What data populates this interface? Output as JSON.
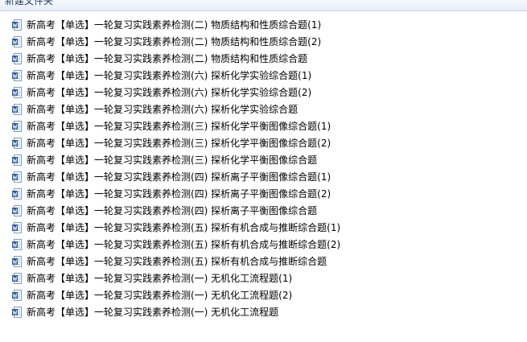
{
  "toolbar": {
    "new_folder_label": "新建文件夹"
  },
  "files": [
    {
      "name": "新高考【单选】一轮复习实践素养检测(二)   物质结构和性质综合题(1)",
      "icon": "word-document-icon"
    },
    {
      "name": "新高考【单选】一轮复习实践素养检测(二)   物质结构和性质综合题(2)",
      "icon": "word-document-icon"
    },
    {
      "name": "新高考【单选】一轮复习实践素养检测(二)   物质结构和性质综合题",
      "icon": "word-document-icon"
    },
    {
      "name": "新高考【单选】一轮复习实践素养检测(六)   探析化学实验综合题(1)",
      "icon": "word-document-icon"
    },
    {
      "name": "新高考【单选】一轮复习实践素养检测(六)   探析化学实验综合题(2)",
      "icon": "word-document-icon"
    },
    {
      "name": "新高考【单选】一轮复习实践素养检测(六)   探析化学实验综合题",
      "icon": "word-document-icon"
    },
    {
      "name": "新高考【单选】一轮复习实践素养检测(三)   探析化学平衡图像综合题(1)",
      "icon": "word-document-icon"
    },
    {
      "name": "新高考【单选】一轮复习实践素养检测(三)   探析化学平衡图像综合题(2)",
      "icon": "word-document-icon"
    },
    {
      "name": "新高考【单选】一轮复习实践素养检测(三)   探析化学平衡图像综合题",
      "icon": "word-document-icon"
    },
    {
      "name": "新高考【单选】一轮复习实践素养检测(四)   探析离子平衡图像综合题(1)",
      "icon": "word-document-icon"
    },
    {
      "name": "新高考【单选】一轮复习实践素养检测(四)   探析离子平衡图像综合题(2)",
      "icon": "word-document-icon"
    },
    {
      "name": "新高考【单选】一轮复习实践素养检测(四)   探析离子平衡图像综合题",
      "icon": "word-document-icon"
    },
    {
      "name": "新高考【单选】一轮复习实践素养检测(五)   探析有机合成与推断综合题(1)",
      "icon": "word-document-icon"
    },
    {
      "name": "新高考【单选】一轮复习实践素养检测(五)   探析有机合成与推断综合题(2)",
      "icon": "word-document-icon"
    },
    {
      "name": "新高考【单选】一轮复习实践素养检测(五)   探析有机合成与推断综合题",
      "icon": "word-document-icon"
    },
    {
      "name": "新高考【单选】一轮复习实践素养检测(一)   无机化工流程题(1)",
      "icon": "word-document-icon"
    },
    {
      "name": "新高考【单选】一轮复习实践素养检测(一)   无机化工流程题(2)",
      "icon": "word-document-icon"
    },
    {
      "name": "新高考【单选】一轮复习实践素养检测(一)   无机化工流程题",
      "icon": "word-document-icon"
    }
  ],
  "colors": {
    "icon_blue": "#2b579a",
    "icon_page": "#ffffff",
    "icon_border": "#7f9db9"
  }
}
